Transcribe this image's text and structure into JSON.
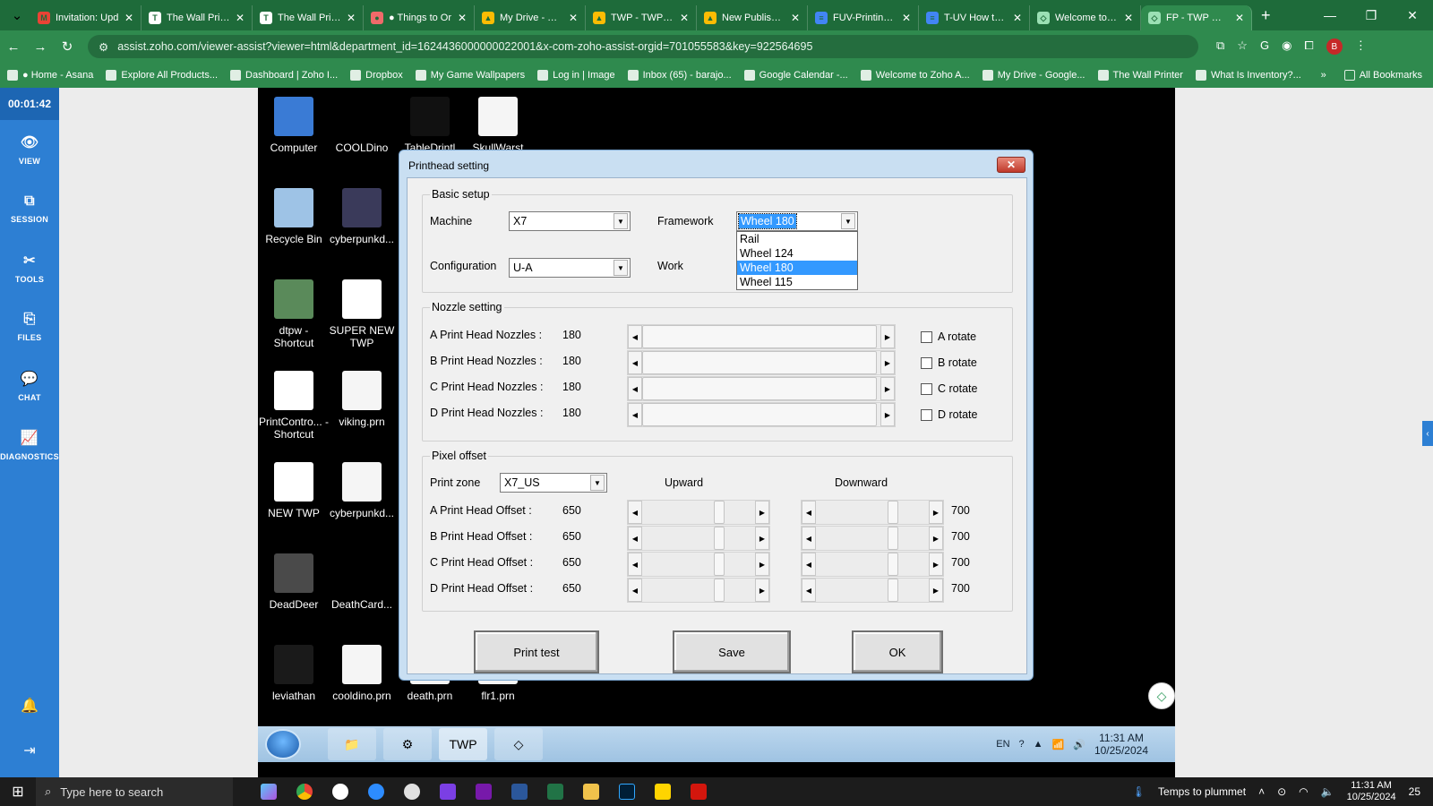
{
  "browser": {
    "tabs": [
      {
        "title": "Invitation: Upd",
        "icon": "gmail-icon",
        "color": "#ea4335",
        "glyph": "M"
      },
      {
        "title": "The Wall Printe",
        "icon": "twp-icon",
        "color": "#ffffff",
        "glyph": "T"
      },
      {
        "title": "The Wall Printe",
        "icon": "twp-icon",
        "color": "#ffffff",
        "glyph": "T"
      },
      {
        "title": "● Things to Or",
        "icon": "asana-icon",
        "color": "#f06a6a",
        "glyph": "●"
      },
      {
        "title": "My Drive - Goo",
        "icon": "drive-icon",
        "color": "#fbbc04",
        "glyph": "▲"
      },
      {
        "title": "TWP - TWP Su",
        "icon": "drive-icon",
        "color": "#fbbc04",
        "glyph": "▲"
      },
      {
        "title": "New Published",
        "icon": "drive-icon",
        "color": "#fbbc04",
        "glyph": "▲"
      },
      {
        "title": "FUV-Printing U",
        "icon": "docs-icon",
        "color": "#4285f4",
        "glyph": "≡"
      },
      {
        "title": "T-UV How to P",
        "icon": "docs-icon",
        "color": "#4285f4",
        "glyph": "≡"
      },
      {
        "title": "Welcome to Zo",
        "icon": "zoho-icon",
        "color": "#9be0b4",
        "glyph": "◇"
      },
      {
        "title": "FP - TWP Ware",
        "icon": "zoho-icon",
        "color": "#9be0b4",
        "glyph": "◇"
      }
    ],
    "url": "assist.zoho.com/viewer-assist?viewer=html&department_id=1624436000000022001&x-com-zoho-assist-orgid=701055583&key=922564695",
    "profile_initial": "B",
    "bookmarks": [
      "● Home - Asana",
      "Explore All Products...",
      "Dashboard | Zoho I...",
      "Dropbox",
      "My Game Wallpapers",
      "Log in | Image",
      "Inbox (65) - barajo...",
      "Google Calendar -...",
      "Welcome to Zoho A...",
      "My Drive - Google...",
      "The Wall Printer",
      "What Is Inventory?..."
    ],
    "all_bookmarks": "All Bookmarks",
    "more": "»"
  },
  "zoho": {
    "timer": "00:01:42",
    "nav": [
      {
        "label": "VIEW",
        "icon": "eye-icon",
        "glyph": "👁"
      },
      {
        "label": "SESSION",
        "icon": "session-icon",
        "glyph": "⧉"
      },
      {
        "label": "TOOLS",
        "icon": "tools-icon",
        "glyph": "✂"
      },
      {
        "label": "FILES",
        "icon": "files-icon",
        "glyph": "⎘"
      },
      {
        "label": "CHAT",
        "icon": "chat-icon",
        "glyph": "💬"
      },
      {
        "label": "DIAGNOSTICS",
        "icon": "diagnostics-icon",
        "glyph": "📈"
      }
    ]
  },
  "desktop": {
    "icons": [
      {
        "label": "Computer",
        "color": "#3a7bd5"
      },
      {
        "label": "COOLDino",
        "color": "#000000"
      },
      {
        "label": "TableDrintl",
        "color": "#111111"
      },
      {
        "label": "SkullWarst",
        "color": "#f5f5f5"
      },
      {
        "label": "Recycle Bin",
        "color": "#9ec3e6"
      },
      {
        "label": "cyberpunkd...",
        "color": "#3a3a5a"
      },
      {
        "label": "dtpw - Shortcut",
        "color": "#5a8a5a"
      },
      {
        "label": "SUPER NEW TWP",
        "color": "#ffffff"
      },
      {
        "label": "PrintContro... - Shortcut",
        "color": "#ffffff"
      },
      {
        "label": "viking.prn",
        "color": "#f5f5f5"
      },
      {
        "label": "NEW TWP",
        "color": "#ffffff"
      },
      {
        "label": "cyberpunkd...",
        "color": "#f5f5f5"
      },
      {
        "label": "DeadDeer",
        "color": "#4a4a4a"
      },
      {
        "label": "DeathCard...",
        "color": "#000000"
      },
      {
        "label": "leviathan",
        "color": "#1a1a1a"
      },
      {
        "label": "cooldino.prn",
        "color": "#f5f5f5"
      },
      {
        "label": "death.prn",
        "color": "#f5f5f5"
      },
      {
        "label": "flr1.prn",
        "color": "#f5f5f5"
      }
    ]
  },
  "dialog": {
    "title": "Printhead setting",
    "close": "✕",
    "basic": {
      "title": "Basic setup",
      "machine_label": "Machine",
      "machine_value": "X7",
      "framework_label": "Framework",
      "framework_value": "Wheel 180",
      "config_label": "Configuration",
      "config_value": "U-A",
      "work_label": "Work",
      "framework_options": [
        "Rail",
        "Wheel 124",
        "Wheel 180",
        "Wheel 115"
      ]
    },
    "nozzle": {
      "title": "Nozzle setting",
      "rows": [
        {
          "label": "A Print Head Nozzles :",
          "value": "180",
          "rotate": "A rotate"
        },
        {
          "label": "B Print Head Nozzles :",
          "value": "180",
          "rotate": "B rotate"
        },
        {
          "label": "C Print Head Nozzles :",
          "value": "180",
          "rotate": "C rotate"
        },
        {
          "label": "D Print Head Nozzles :",
          "value": "180",
          "rotate": "D rotate"
        }
      ]
    },
    "pixel": {
      "title": "Pixel offset",
      "zone_label": "Print zone",
      "zone_value": "X7_US",
      "upward": "Upward",
      "downward": "Downward",
      "rows": [
        {
          "label": "A Print Head Offset :",
          "up": "650",
          "down": "700"
        },
        {
          "label": "B Print Head Offset :",
          "up": "650",
          "down": "700"
        },
        {
          "label": "C Print Head Offset :",
          "up": "650",
          "down": "700"
        },
        {
          "label": "D Print Head Offset :",
          "up": "650",
          "down": "700"
        }
      ]
    },
    "buttons": {
      "print_test": "Print test",
      "save": "Save",
      "ok": "OK"
    }
  },
  "win7_taskbar": {
    "lang": "EN",
    "time": "11:31 AM",
    "date": "10/25/2024"
  },
  "win10_taskbar": {
    "search_placeholder": "Type here to search",
    "weather": "Temps to plummet",
    "time": "11:31 AM",
    "date": "10/25/2024",
    "notif_count": "25"
  }
}
